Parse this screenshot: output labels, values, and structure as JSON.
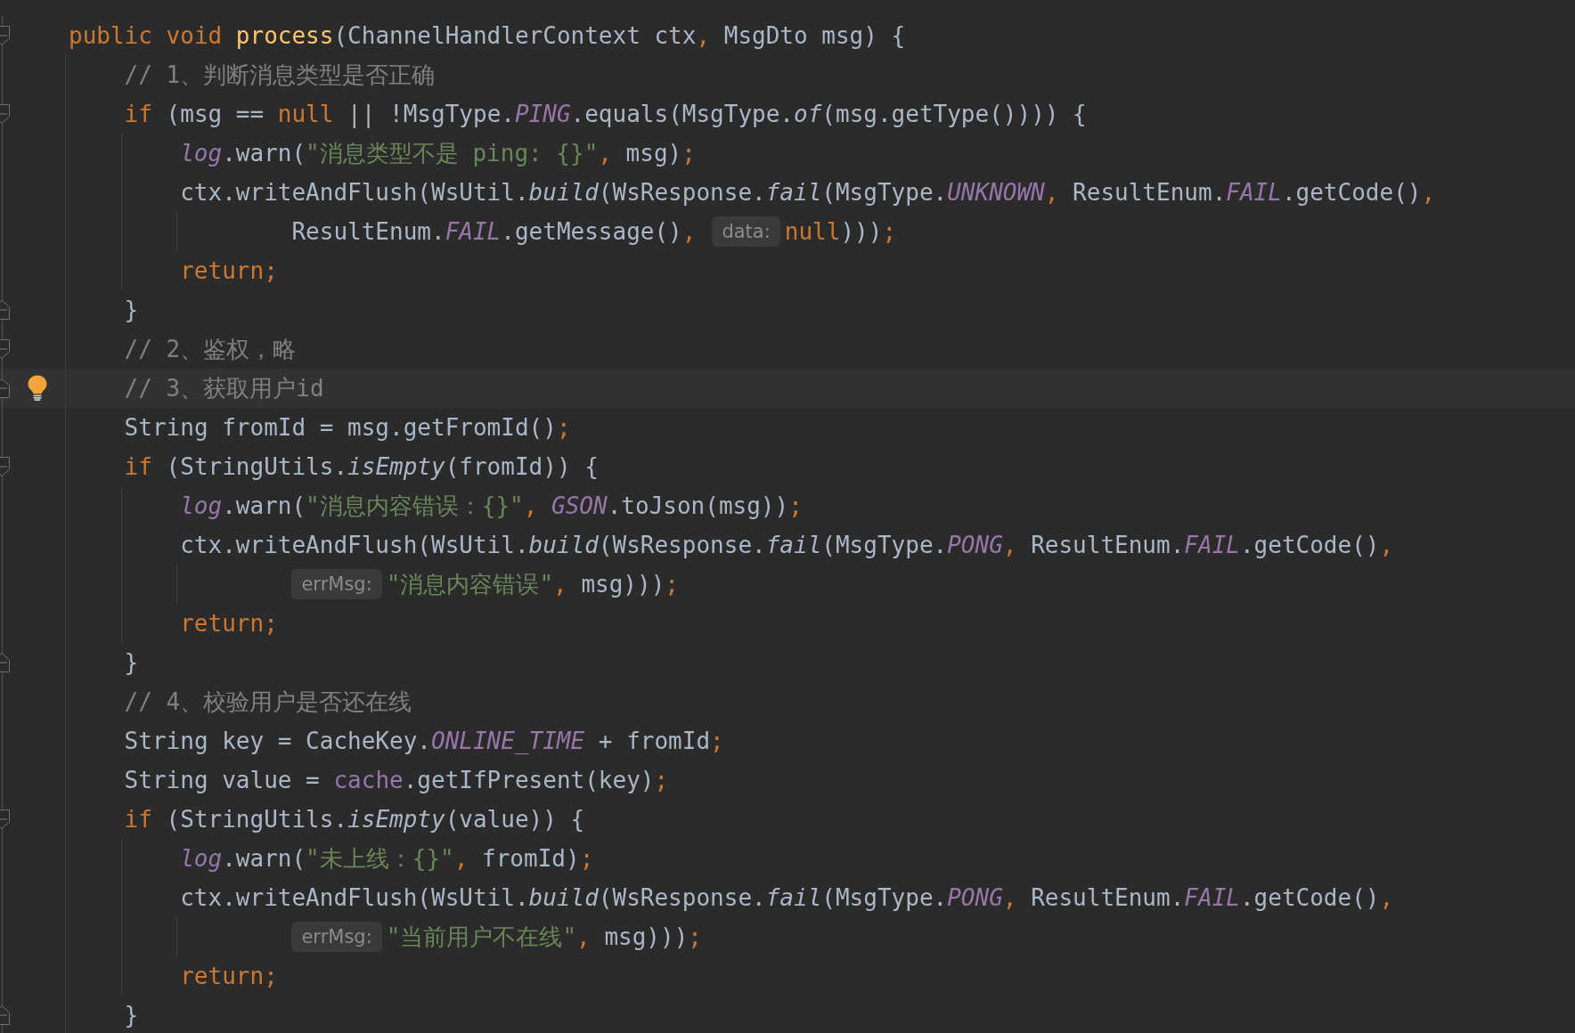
{
  "editor": {
    "lines": [
      {
        "current": false,
        "fold": {
          "kind": "start"
        },
        "tokens": [
          {
            "kind": "keyword",
            "text": "public void "
          },
          {
            "kind": "method_decl",
            "text": "process"
          },
          {
            "kind": "plain",
            "text": "(ChannelHandlerContext ctx"
          },
          {
            "kind": "punct",
            "text": ","
          },
          {
            "kind": "plain",
            "text": " MsgDto msg) {"
          }
        ],
        "children": [
          {
            "current": false,
            "tokens": [
              {
                "kind": "comment",
                "text": "// 1、判断消息类型是否正确"
              }
            ]
          },
          {
            "current": false,
            "fold": {
              "kind": "start"
            },
            "tokens": [
              {
                "kind": "keyword",
                "text": "if "
              },
              {
                "kind": "plain",
                "text": "(msg == "
              },
              {
                "kind": "keyword",
                "text": "null "
              },
              {
                "kind": "plain",
                "text": "|| !MsgType."
              },
              {
                "kind": "static_field",
                "text": "PING"
              },
              {
                "kind": "plain",
                "text": ".equals(MsgType."
              },
              {
                "kind": "static_call",
                "text": "of"
              },
              {
                "kind": "plain",
                "text": "(msg.getType()))) {"
              }
            ],
            "children": [
              {
                "current": false,
                "tokens": [
                  {
                    "kind": "static_field",
                    "text": "log"
                  },
                  {
                    "kind": "plain",
                    "text": ".warn("
                  },
                  {
                    "kind": "string",
                    "text": "\"消息类型不是 ping: {}\""
                  },
                  {
                    "kind": "punct",
                    "text": ", "
                  },
                  {
                    "kind": "plain",
                    "text": "msg)"
                  },
                  {
                    "kind": "punct",
                    "text": ";"
                  }
                ]
              },
              {
                "current": false,
                "tokens": [
                  {
                    "kind": "plain",
                    "text": "ctx.writeAndFlush(WsUtil."
                  },
                  {
                    "kind": "static_call",
                    "text": "build"
                  },
                  {
                    "kind": "plain",
                    "text": "(WsResponse."
                  },
                  {
                    "kind": "static_call",
                    "text": "fail"
                  },
                  {
                    "kind": "plain",
                    "text": "(MsgType."
                  },
                  {
                    "kind": "static_field",
                    "text": "UNKNOWN"
                  },
                  {
                    "kind": "punct",
                    "text": ", "
                  },
                  {
                    "kind": "plain",
                    "text": "ResultEnum."
                  },
                  {
                    "kind": "static_field",
                    "text": "FAIL"
                  },
                  {
                    "kind": "plain",
                    "text": ".getCode()"
                  },
                  {
                    "kind": "punct",
                    "text": ","
                  }
                ],
                "continuation": [
                  {
                    "current": false,
                    "tokens": [
                      {
                        "kind": "plain",
                        "text": "ResultEnum."
                      },
                      {
                        "kind": "static_field",
                        "text": "FAIL"
                      },
                      {
                        "kind": "plain",
                        "text": ".getMessage()"
                      },
                      {
                        "kind": "punct",
                        "text": ","
                      },
                      {
                        "kind": "hint",
                        "text": "data:"
                      },
                      {
                        "kind": "keyword",
                        "text": "null"
                      },
                      {
                        "kind": "plain",
                        "text": ")))"
                      },
                      {
                        "kind": "punct",
                        "text": ";"
                      }
                    ]
                  }
                ]
              },
              {
                "current": false,
                "tokens": [
                  {
                    "kind": "keyword",
                    "text": "return"
                  },
                  {
                    "kind": "punct",
                    "text": ";"
                  }
                ]
              }
            ]
          },
          {
            "current": false,
            "fold": {
              "kind": "end"
            },
            "tokens": [
              {
                "kind": "plain",
                "text": "}"
              }
            ]
          },
          {
            "current": false,
            "fold": {
              "kind": "start"
            },
            "tokens": [
              {
                "kind": "comment",
                "text": "// 2、鉴权，略"
              }
            ]
          },
          {
            "current": true,
            "fold": {
              "kind": "end"
            },
            "tokens": [
              {
                "kind": "comment",
                "text": "// 3、获取用户id"
              }
            ]
          },
          {
            "current": false,
            "tokens": [
              {
                "kind": "plain",
                "text": "String fromId = msg.getFromId()"
              },
              {
                "kind": "punct",
                "text": ";"
              }
            ]
          },
          {
            "current": false,
            "fold": {
              "kind": "start"
            },
            "tokens": [
              {
                "kind": "keyword",
                "text": "if "
              },
              {
                "kind": "plain",
                "text": "(StringUtils."
              },
              {
                "kind": "static_call",
                "text": "isEmpty"
              },
              {
                "kind": "plain",
                "text": "(fromId)) {"
              }
            ],
            "children": [
              {
                "current": false,
                "tokens": [
                  {
                    "kind": "static_field",
                    "text": "log"
                  },
                  {
                    "kind": "plain",
                    "text": ".warn("
                  },
                  {
                    "kind": "string",
                    "text": "\"消息内容错误：{}\""
                  },
                  {
                    "kind": "punct",
                    "text": ", "
                  },
                  {
                    "kind": "static_field",
                    "text": "GSON"
                  },
                  {
                    "kind": "plain",
                    "text": ".toJson(msg))"
                  },
                  {
                    "kind": "punct",
                    "text": ";"
                  }
                ]
              },
              {
                "current": false,
                "tokens": [
                  {
                    "kind": "plain",
                    "text": "ctx.writeAndFlush(WsUtil."
                  },
                  {
                    "kind": "static_call",
                    "text": "build"
                  },
                  {
                    "kind": "plain",
                    "text": "(WsResponse."
                  },
                  {
                    "kind": "static_call",
                    "text": "fail"
                  },
                  {
                    "kind": "plain",
                    "text": "(MsgType."
                  },
                  {
                    "kind": "static_field",
                    "text": "PONG"
                  },
                  {
                    "kind": "punct",
                    "text": ", "
                  },
                  {
                    "kind": "plain",
                    "text": "ResultEnum."
                  },
                  {
                    "kind": "static_field",
                    "text": "FAIL"
                  },
                  {
                    "kind": "plain",
                    "text": ".getCode()"
                  },
                  {
                    "kind": "punct",
                    "text": ","
                  }
                ],
                "continuation": [
                  {
                    "current": false,
                    "tokens": [
                      {
                        "kind": "hint",
                        "text": "errMsg:"
                      },
                      {
                        "kind": "string",
                        "text": "\"消息内容错误\""
                      },
                      {
                        "kind": "punct",
                        "text": ", "
                      },
                      {
                        "kind": "plain",
                        "text": "msg)))"
                      },
                      {
                        "kind": "punct",
                        "text": ";"
                      }
                    ]
                  }
                ]
              },
              {
                "current": false,
                "tokens": [
                  {
                    "kind": "keyword",
                    "text": "return"
                  },
                  {
                    "kind": "punct",
                    "text": ";"
                  }
                ]
              }
            ]
          },
          {
            "current": false,
            "fold": {
              "kind": "end"
            },
            "tokens": [
              {
                "kind": "plain",
                "text": "}"
              }
            ]
          },
          {
            "current": false,
            "tokens": [
              {
                "kind": "comment",
                "text": "// 4、校验用户是否还在线"
              }
            ]
          },
          {
            "current": false,
            "tokens": [
              {
                "kind": "plain",
                "text": "String key = CacheKey."
              },
              {
                "kind": "static_field",
                "text": "ONLINE_TIME"
              },
              {
                "kind": "plain",
                "text": " + fromId"
              },
              {
                "kind": "punct",
                "text": ";"
              }
            ]
          },
          {
            "current": false,
            "tokens": [
              {
                "kind": "plain",
                "text": "String value = "
              },
              {
                "kind": "field",
                "text": "cache"
              },
              {
                "kind": "plain",
                "text": ".getIfPresent(key)"
              },
              {
                "kind": "punct",
                "text": ";"
              }
            ]
          },
          {
            "current": false,
            "fold": {
              "kind": "start"
            },
            "tokens": [
              {
                "kind": "keyword",
                "text": "if "
              },
              {
                "kind": "plain",
                "text": "(StringUtils."
              },
              {
                "kind": "static_call",
                "text": "isEmpty"
              },
              {
                "kind": "plain",
                "text": "(value)) {"
              }
            ],
            "children": [
              {
                "current": false,
                "tokens": [
                  {
                    "kind": "static_field",
                    "text": "log"
                  },
                  {
                    "kind": "plain",
                    "text": ".warn("
                  },
                  {
                    "kind": "string",
                    "text": "\"未上线：{}\""
                  },
                  {
                    "kind": "punct",
                    "text": ", "
                  },
                  {
                    "kind": "plain",
                    "text": "fromId)"
                  },
                  {
                    "kind": "punct",
                    "text": ";"
                  }
                ]
              },
              {
                "current": false,
                "tokens": [
                  {
                    "kind": "plain",
                    "text": "ctx.writeAndFlush(WsUtil."
                  },
                  {
                    "kind": "static_call",
                    "text": "build"
                  },
                  {
                    "kind": "plain",
                    "text": "(WsResponse."
                  },
                  {
                    "kind": "static_call",
                    "text": "fail"
                  },
                  {
                    "kind": "plain",
                    "text": "(MsgType."
                  },
                  {
                    "kind": "static_field",
                    "text": "PONG"
                  },
                  {
                    "kind": "punct",
                    "text": ", "
                  },
                  {
                    "kind": "plain",
                    "text": "ResultEnum."
                  },
                  {
                    "kind": "static_field",
                    "text": "FAIL"
                  },
                  {
                    "kind": "plain",
                    "text": ".getCode()"
                  },
                  {
                    "kind": "punct",
                    "text": ","
                  }
                ],
                "continuation": [
                  {
                    "current": false,
                    "tokens": [
                      {
                        "kind": "hint",
                        "text": "errMsg:"
                      },
                      {
                        "kind": "string",
                        "text": "\"当前用户不在线\""
                      },
                      {
                        "kind": "punct",
                        "text": ", "
                      },
                      {
                        "kind": "plain",
                        "text": "msg)))"
                      },
                      {
                        "kind": "punct",
                        "text": ";"
                      }
                    ]
                  }
                ]
              },
              {
                "current": false,
                "tokens": [
                  {
                    "kind": "keyword",
                    "text": "return"
                  },
                  {
                    "kind": "punct",
                    "text": ";"
                  }
                ]
              }
            ]
          },
          {
            "current": false,
            "fold": {
              "kind": "end"
            },
            "tokens": [
              {
                "kind": "plain",
                "text": "}"
              }
            ]
          }
        ]
      }
    ]
  }
}
